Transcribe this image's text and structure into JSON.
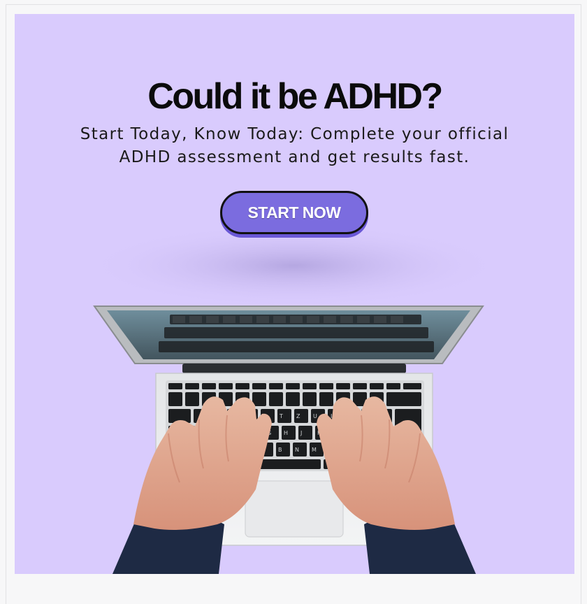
{
  "banner": {
    "headline": "Could it be ADHD?",
    "subtitle": "Start Today, Know Today: Complete your official ADHD assessment and get results fast.",
    "cta_label": "START NOW",
    "background_color": "#d9cbfd",
    "button_color": "#7b6cdf"
  },
  "image": {
    "subject": "laptop-typing-hands-photo"
  }
}
